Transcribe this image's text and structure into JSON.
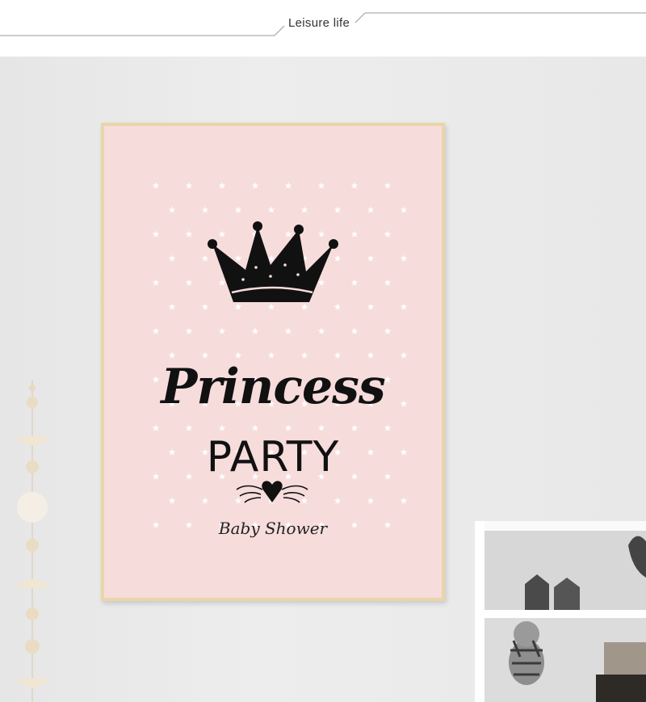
{
  "header": {
    "title": "Leisure life"
  },
  "poster": {
    "title_line1": "Princess",
    "title_line2": "PARTY",
    "subtitle": "Baby Shower"
  },
  "colors": {
    "poster_background": "#f7dcdc",
    "frame": "#e8d6a8",
    "ink": "#111111",
    "wall": "#ebebeb"
  },
  "icons": [
    "crown-icon",
    "heart-with-wings-icon",
    "star-icon"
  ]
}
